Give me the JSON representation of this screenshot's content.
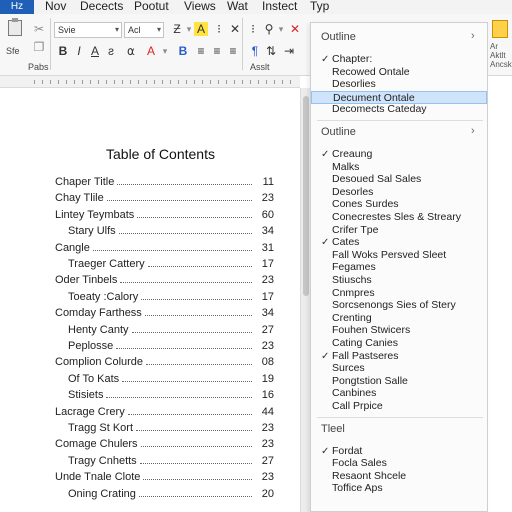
{
  "menubar": {
    "file_label": "Hz",
    "items": [
      "Nov",
      "Decects",
      "Pootut",
      "Views",
      "Wat",
      "Instect",
      "Typ"
    ]
  },
  "ribbon": {
    "font_name": "Svie",
    "font_size": "Acl",
    "paste_label": "Sfe",
    "group_label": "Pabs",
    "styles_label": "Asslt",
    "right_group_label_1": "Ar",
    "right_group_label_2": "Aktlt",
    "right_group_label_3": "Ancsk"
  },
  "document": {
    "toc_title": "Table of Contents",
    "entries": [
      {
        "title": "Chaper Title",
        "page": "11",
        "indent": 0
      },
      {
        "title": "Chay Tlile",
        "page": "23",
        "indent": 0
      },
      {
        "title": "Lintey Teymbats",
        "page": "60",
        "indent": 0
      },
      {
        "title": "Stary Ulfs",
        "page": "34",
        "indent": 1
      },
      {
        "title": "Cangle",
        "page": "31",
        "indent": 0
      },
      {
        "title": "Traeger Cattery",
        "page": "17",
        "indent": 1
      },
      {
        "title": "Oder Tinbels",
        "page": "23",
        "indent": 0
      },
      {
        "title": "Toeaty :Calory",
        "page": "17",
        "indent": 1
      },
      {
        "title": "Comday Farthess",
        "page": "34",
        "indent": 0
      },
      {
        "title": "Henty Canty",
        "page": "27",
        "indent": 1
      },
      {
        "title": "Peplosse",
        "page": "23",
        "indent": 1
      },
      {
        "title": "Complion Colurde",
        "page": "08",
        "indent": 0
      },
      {
        "title": "Of To Kats",
        "page": "19",
        "indent": 1
      },
      {
        "title": "Stisiets",
        "page": "16",
        "indent": 1
      },
      {
        "title": "Lacrage Crery",
        "page": "44",
        "indent": 0
      },
      {
        "title": "Tragg St Kort",
        "page": "23",
        "indent": 1
      },
      {
        "title": "Comage Chulers",
        "page": "23",
        "indent": 0
      },
      {
        "title": "Tragy Cnhetts",
        "page": "27",
        "indent": 1
      },
      {
        "title": "Unde Tnale Clote",
        "page": "23",
        "indent": 0
      },
      {
        "title": "Oning Crating",
        "page": "20",
        "indent": 1
      }
    ]
  },
  "panel": {
    "sections": [
      {
        "header": "Outline",
        "has_chevron": true,
        "items": [
          {
            "label": "Chapter:",
            "checked": true,
            "selected": false
          },
          {
            "label": "Recowed Ontale",
            "checked": false,
            "selected": false
          },
          {
            "label": "Desorlies",
            "checked": false,
            "selected": false
          },
          {
            "label": "Decument Ontale",
            "checked": false,
            "selected": true
          },
          {
            "label": "Decomects Cateday",
            "checked": false,
            "selected": false
          }
        ]
      },
      {
        "header": "Outline",
        "has_chevron": true,
        "items": [
          {
            "label": "Creaung",
            "checked": true,
            "selected": false
          },
          {
            "label": "Malks",
            "checked": false,
            "selected": false
          },
          {
            "label": "Desoued Sal Sales",
            "checked": false,
            "selected": false
          },
          {
            "label": "Desorles",
            "checked": false,
            "selected": false
          },
          {
            "label": "Cones Surdes",
            "checked": false,
            "selected": false
          },
          {
            "label": "Conecrestes Sles & Streary",
            "checked": false,
            "selected": false
          },
          {
            "label": "Crifer Tpe",
            "checked": false,
            "selected": false
          },
          {
            "label": "Cates",
            "checked": true,
            "selected": false
          },
          {
            "label": "Fall Woks Persved Sleet",
            "checked": false,
            "selected": false
          },
          {
            "label": "Fegames",
            "checked": false,
            "selected": false
          },
          {
            "label": "Stiuschs",
            "checked": false,
            "selected": false
          },
          {
            "label": "Cnmpres",
            "checked": false,
            "selected": false
          },
          {
            "label": "Sorcsenongs Sies of Stery",
            "checked": false,
            "selected": false
          },
          {
            "label": "Crenting",
            "checked": false,
            "selected": false
          },
          {
            "label": "Fouhen Stwicers",
            "checked": false,
            "selected": false
          },
          {
            "label": "Cating Canies",
            "checked": false,
            "selected": false
          },
          {
            "label": "Fall Pastseres",
            "checked": true,
            "selected": false
          },
          {
            "label": "Surces",
            "checked": false,
            "selected": false
          },
          {
            "label": "Pongtstion Salle",
            "checked": false,
            "selected": false
          },
          {
            "label": "Canbines",
            "checked": false,
            "selected": false
          },
          {
            "label": "Call Prpice",
            "checked": false,
            "selected": false
          }
        ]
      },
      {
        "header": "Tleel",
        "has_chevron": false,
        "items": [
          {
            "label": "Fordat",
            "checked": true,
            "selected": false
          },
          {
            "label": "Focla Sales",
            "checked": false,
            "selected": false
          },
          {
            "label": "Resaont Shcele",
            "checked": false,
            "selected": false
          },
          {
            "label": "Toffice Aps",
            "checked": false,
            "selected": false
          }
        ]
      }
    ]
  }
}
